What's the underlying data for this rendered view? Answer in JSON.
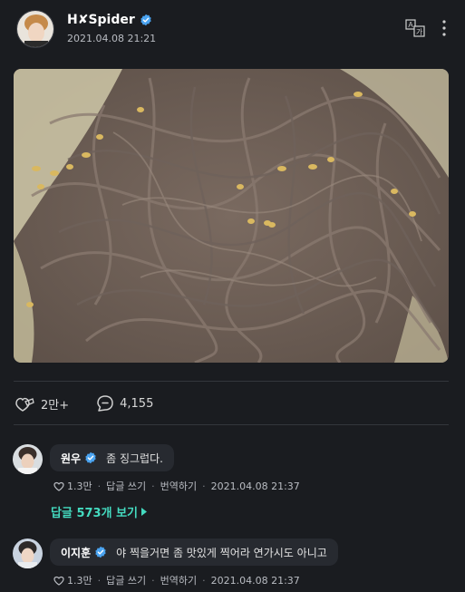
{
  "post": {
    "author": "H✘Spider",
    "time": "2021.04.08 21:21",
    "likes": "2만+",
    "comments": "4,155"
  },
  "comments": [
    {
      "name": "원우",
      "text": "좀 징그럽다.",
      "likes": "1.3만",
      "reply_label": "답글 쓰기",
      "translate_label": "번역하기",
      "time": "2021.04.08 21:37"
    },
    {
      "name": "이지훈",
      "text": "야 찍을거면 좀 맛있게 찍어라 연가시도 아니고",
      "likes": "1.3만",
      "reply_label": "답글 쓰기",
      "translate_label": "번역하기",
      "time": "2021.04.08 21:37"
    }
  ],
  "replies_link": "답글 573개 보기",
  "colors": {
    "accent": "#44dbc0",
    "verified": "#4aa3f0",
    "background": "#1a1c20"
  },
  "icons": [
    "translate-icon",
    "more-vertical-icon",
    "like-icon",
    "comment-icon",
    "verified-badge-icon",
    "caret-right-icon"
  ]
}
